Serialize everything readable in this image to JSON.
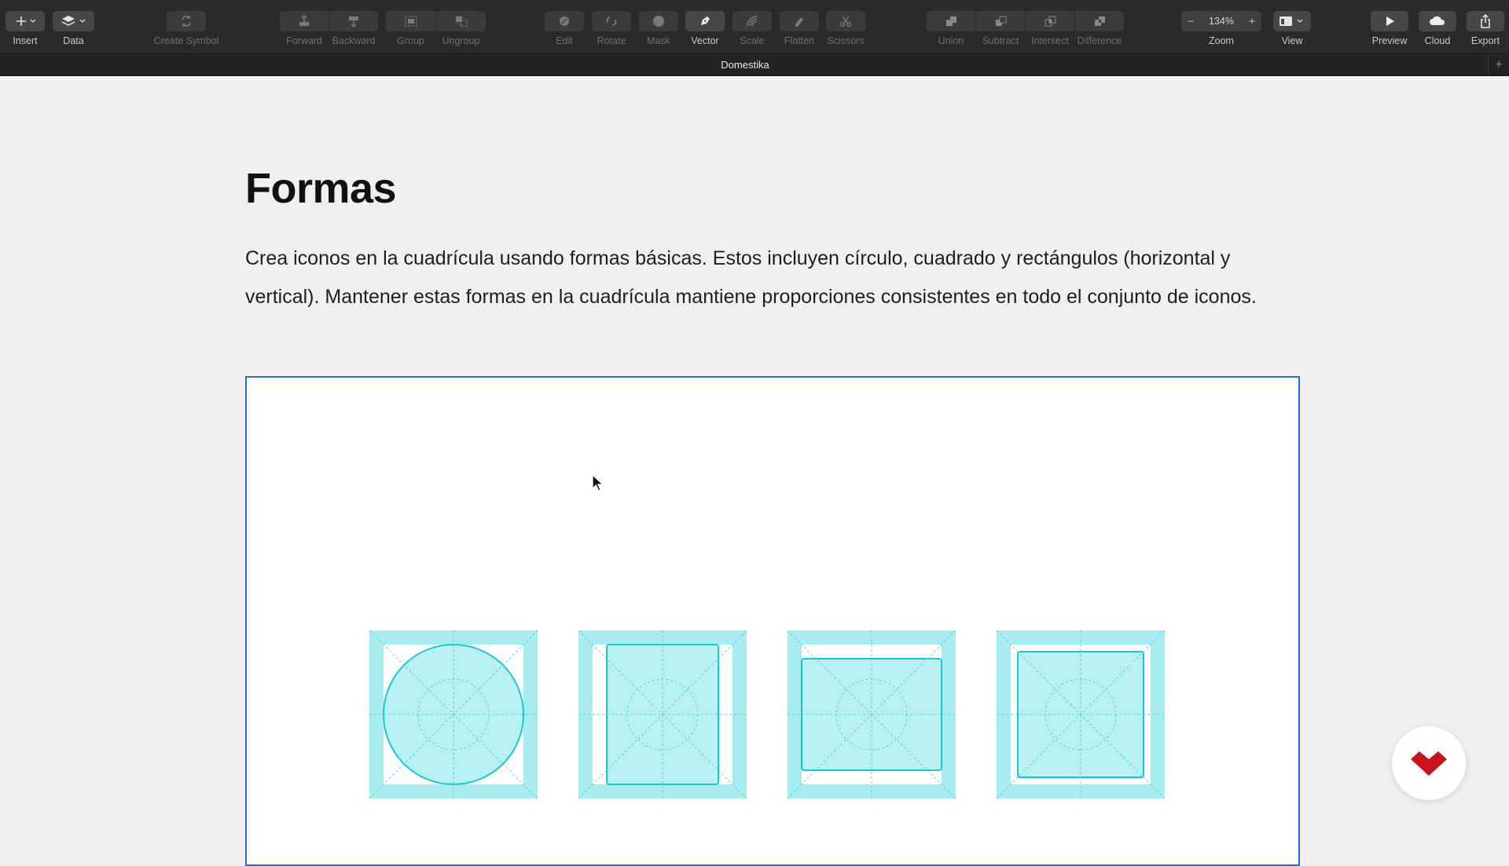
{
  "toolbar": {
    "insert": "Insert",
    "data": "Data",
    "create_symbol": "Create Symbol",
    "forward": "Forward",
    "backward": "Backward",
    "group": "Group",
    "ungroup": "Ungroup",
    "edit": "Edit",
    "rotate": "Rotate",
    "mask": "Mask",
    "vector": "Vector",
    "scale": "Scale",
    "flatten": "Flatten",
    "scissors": "Scissors",
    "union": "Union",
    "subtract": "Subtract",
    "intersect": "Intersect",
    "difference": "Difference",
    "zoom_label": "Zoom",
    "zoom_value": "134%",
    "view": "View",
    "preview": "Preview",
    "cloud": "Cloud",
    "export": "Export"
  },
  "tabbar": {
    "document_title": "Domestika"
  },
  "content": {
    "title": "Formas",
    "description": "Crea iconos en la cuadrícula usando formas básicas. Estos incluyen círculo, cuadrado y rectángulos (horizontal y vertical). Mantener estas formas en la cuadrícula mantiene proporciones consistentes en todo el conjunto de iconos."
  },
  "colors": {
    "toolbar_bg": "#2a2a2b",
    "artboard_border": "#1e6fd0",
    "grid_fill": "#a8ecef",
    "grid_stroke": "#4fd2da",
    "shape_fill": "#b9f1f1",
    "shape_stroke": "#18c7d2",
    "brand_red": "#c8141e"
  },
  "icons": [
    "plus-icon",
    "layers-icon",
    "symbol-icon",
    "forward-icon",
    "backward-icon",
    "group-icon",
    "ungroup-icon",
    "edit-icon",
    "rotate-icon",
    "mask-icon",
    "vector-pen-icon",
    "scale-icon",
    "flatten-icon",
    "scissors-icon",
    "union-icon",
    "subtract-icon",
    "intersect-icon",
    "difference-icon",
    "zoom-out-icon",
    "zoom-in-icon",
    "view-layout-icon",
    "play-icon",
    "cloud-icon",
    "share-icon",
    "domestika-logo-icon"
  ]
}
